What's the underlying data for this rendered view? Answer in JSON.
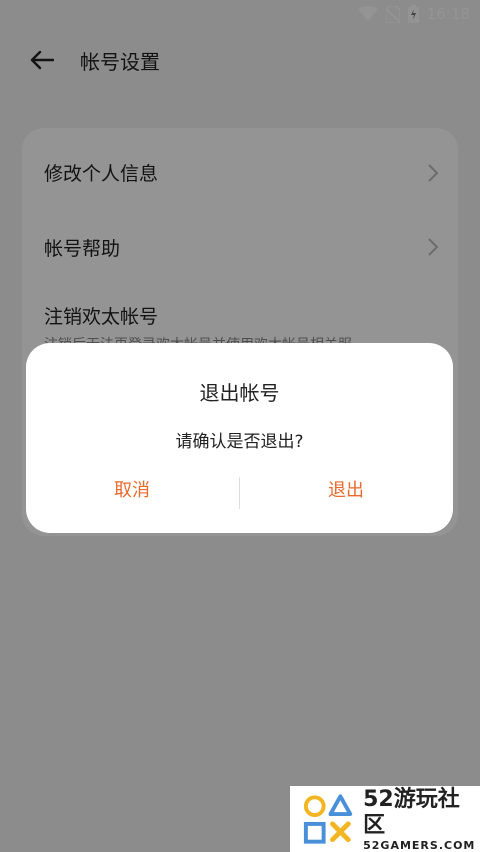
{
  "status_bar": {
    "time": "16:18"
  },
  "header": {
    "title": "帐号设置"
  },
  "settings": {
    "items": [
      {
        "label": "修改个人信息"
      },
      {
        "label": "帐号帮助"
      },
      {
        "label": "注销欢太帐号",
        "description": "注销后无法再登录欢太帐号并使用欢太帐号相关服"
      }
    ]
  },
  "dialog": {
    "title": "退出帐号",
    "message": "请确认是否退出?",
    "cancel_label": "取消",
    "confirm_label": "退出"
  },
  "watermark": {
    "main": "52游玩社区",
    "sub": "52GAMERS.COM"
  },
  "colors": {
    "accent": "#e86a2c",
    "card": "#ffffff",
    "background": "#f2f2f2"
  }
}
